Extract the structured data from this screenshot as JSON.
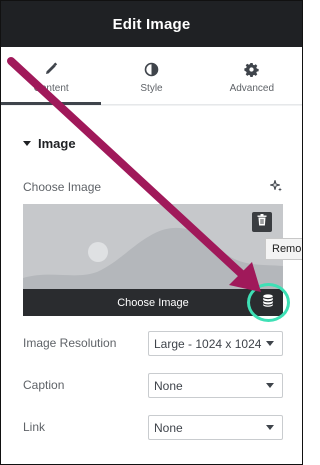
{
  "header": {
    "title": "Edit Image"
  },
  "tabs": [
    {
      "label": "Content",
      "icon": "pencil-icon",
      "active": true
    },
    {
      "label": "Style",
      "icon": "half-circle-icon",
      "active": false
    },
    {
      "label": "Advanced",
      "icon": "gear-icon",
      "active": false
    }
  ],
  "section": {
    "title": "Image",
    "choose_label": "Choose Image",
    "choose_button": "Choose Image",
    "tooltip": "Remo"
  },
  "controls": {
    "resolution": {
      "label": "Image Resolution",
      "value": "Large - 1024 x 1024"
    },
    "caption": {
      "label": "Caption",
      "value": "None"
    },
    "link": {
      "label": "Link",
      "value": "None"
    }
  },
  "colors": {
    "header_bg": "#1f2124",
    "arrow": "#a0195a",
    "highlight": "#3ee0b5"
  }
}
